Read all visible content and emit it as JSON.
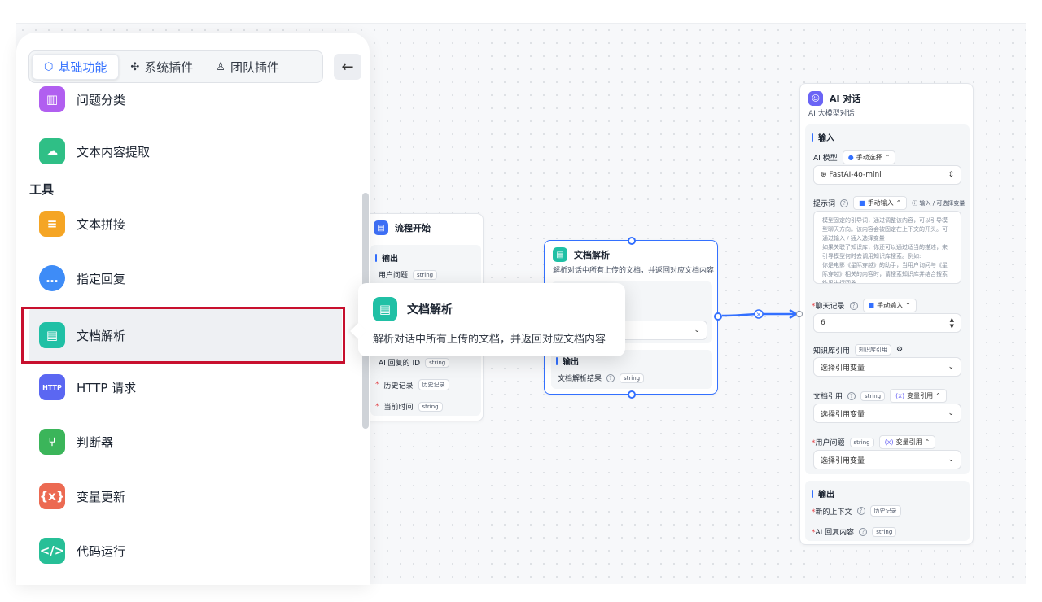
{
  "tabs": [
    {
      "label": "基础功能",
      "icon": "cube-icon"
    },
    {
      "label": "系统插件",
      "icon": "puzzle-icon"
    },
    {
      "label": "团队插件",
      "icon": "user-icon"
    }
  ],
  "menu": {
    "section_tools": "工具",
    "items": [
      {
        "label": "问题分类",
        "color": "#b15ff0"
      },
      {
        "label": "文本内容提取",
        "color": "#2fbf86"
      },
      {
        "label": "文本拼接",
        "color": "#f5a524"
      },
      {
        "label": "指定回复",
        "color": "#3e8cf7"
      },
      {
        "label": "文档解析",
        "color": "#20c0a5"
      },
      {
        "label": "HTTP 请求",
        "color": "#5b67f2"
      },
      {
        "label": "判断器",
        "color": "#3bb55a"
      },
      {
        "label": "变量更新",
        "color": "#ec6a52"
      },
      {
        "label": "代码运行",
        "color": "#27bf97"
      }
    ]
  },
  "tooltip": {
    "title": "文档解析",
    "desc": "解析对话中所有上传的文档，并返回对应文档内容"
  },
  "start_node": {
    "title": "流程开始",
    "output_title": "输出",
    "fields": [
      {
        "label": "用户问题",
        "tag": "string"
      },
      {
        "label": "AI 回复的 ID",
        "tag": "string"
      },
      {
        "label": "历史记录",
        "tag": "历史记录"
      },
      {
        "label": "当前时间",
        "tag": "string"
      }
    ]
  },
  "doc_node": {
    "title": "文档解析",
    "desc": "解析对话中所有上传的文档，并返回对应文档内容",
    "output_title": "输出",
    "output_field": "文档解析结果",
    "output_tag": "string"
  },
  "ai_node": {
    "title": "AI 对话",
    "desc": "AI 大模型对话",
    "input_title": "输入",
    "model_label": "AI 模型",
    "model_mode": "手动选择",
    "model_value": "FastAI-4o-mini",
    "prompt_label": "提示词",
    "prompt_mode": "手动输入",
    "prompt_hint": "输入 / 可选择变量",
    "prompt_text": "模型固定的引导词，通过调整该内容，可以引导模型聊天方向。该内容会被固定在上下文的开头。可通过输入 / 插入选择变量\n如果关联了知识库，你还可以通过适当的描述，来引导模型何时去调用知识库搜索。例如:\n你是电影《星际穿越》的助手，当用户询问与《星际穿越》相关的内容时，请搜索知识库并结合搜索结果进行回答。",
    "history_label": "聊天记录",
    "history_mode": "手动输入",
    "history_value": "6",
    "kb_label": "知识库引用",
    "kb_tag": "知识库引用",
    "kb_placeholder": "选择引用变量",
    "file_label": "文档引用",
    "file_tag": "string",
    "file_mode": "变量引用",
    "file_placeholder": "选择引用变量",
    "question_label": "用户问题",
    "question_tag": "string",
    "question_mode": "变量引用",
    "question_placeholder": "选择引用变量",
    "output_title": "输出",
    "out_context": "新的上下文",
    "out_context_tag": "历史记录",
    "out_reply": "AI 回复内容",
    "out_reply_tag": "string"
  }
}
